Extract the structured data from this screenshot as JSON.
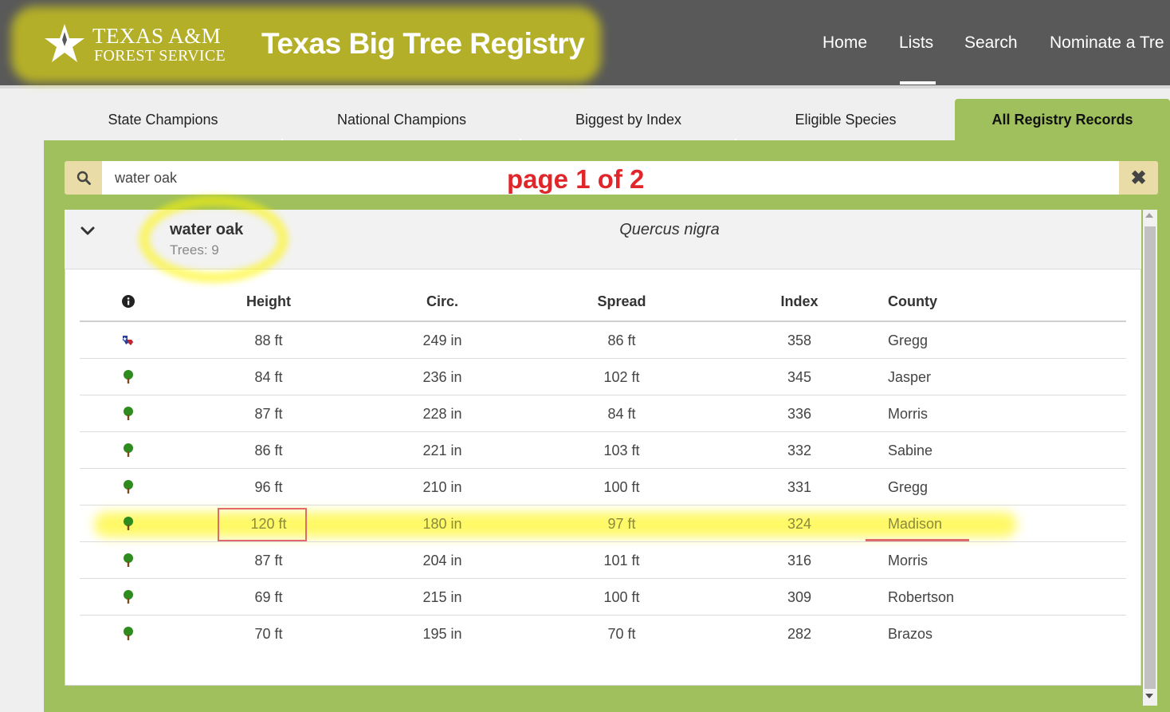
{
  "header": {
    "logo_line1": "TEXAS A&M",
    "logo_line2": "FOREST SERVICE",
    "site_title": "Texas Big Tree Registry",
    "nav": [
      {
        "label": "Home"
      },
      {
        "label": "Lists",
        "active": true
      },
      {
        "label": "Search"
      },
      {
        "label": "Nominate a Tre"
      }
    ]
  },
  "tabs": [
    {
      "label": "State Champions"
    },
    {
      "label": "National Champions"
    },
    {
      "label": "Biggest by Index"
    },
    {
      "label": "Eligible Species"
    },
    {
      "label": "All Registry Records",
      "active": true
    }
  ],
  "search": {
    "value": "water oak",
    "search_icon": "search-icon",
    "clear_icon": "close-icon",
    "clear_symbol": "✖"
  },
  "annotation": {
    "page_text": "page 1 of 2",
    "highlight_color": "#fff500",
    "mark_color": "#e0262a"
  },
  "species": {
    "common_name": "water oak",
    "tree_count": "Trees: 9",
    "scientific_name": "Quercus nigra"
  },
  "table": {
    "info_icon": "info-icon",
    "columns": [
      "Height",
      "Circ.",
      "Spread",
      "Index",
      "County"
    ],
    "rows": [
      {
        "icon": "texas-flag-icon",
        "height": "88 ft",
        "circ": "249 in",
        "spread": "86 ft",
        "index": "358",
        "county": "Gregg"
      },
      {
        "icon": "tree-icon",
        "height": "84 ft",
        "circ": "236 in",
        "spread": "102 ft",
        "index": "345",
        "county": "Jasper"
      },
      {
        "icon": "tree-icon",
        "height": "87 ft",
        "circ": "228 in",
        "spread": "84 ft",
        "index": "336",
        "county": "Morris"
      },
      {
        "icon": "tree-icon",
        "height": "86 ft",
        "circ": "221 in",
        "spread": "103 ft",
        "index": "332",
        "county": "Sabine"
      },
      {
        "icon": "tree-icon",
        "height": "96 ft",
        "circ": "210 in",
        "spread": "100 ft",
        "index": "331",
        "county": "Gregg"
      },
      {
        "icon": "tree-icon",
        "height": "120 ft",
        "circ": "180 in",
        "spread": "97 ft",
        "index": "324",
        "county": "Madison",
        "highlighted": true
      },
      {
        "icon": "tree-icon",
        "height": "87 ft",
        "circ": "204 in",
        "spread": "101 ft",
        "index": "316",
        "county": "Morris"
      },
      {
        "icon": "tree-icon",
        "height": "69 ft",
        "circ": "215 in",
        "spread": "100 ft",
        "index": "309",
        "county": "Robertson"
      },
      {
        "icon": "tree-icon",
        "height": "70 ft",
        "circ": "195 in",
        "spread": "70 ft",
        "index": "282",
        "county": "Brazos"
      }
    ]
  },
  "colors": {
    "header_bg": "#595959",
    "panel_green": "#9fc05c",
    "search_addon": "#e9dca6",
    "tree_green": "#2e8b1e"
  }
}
